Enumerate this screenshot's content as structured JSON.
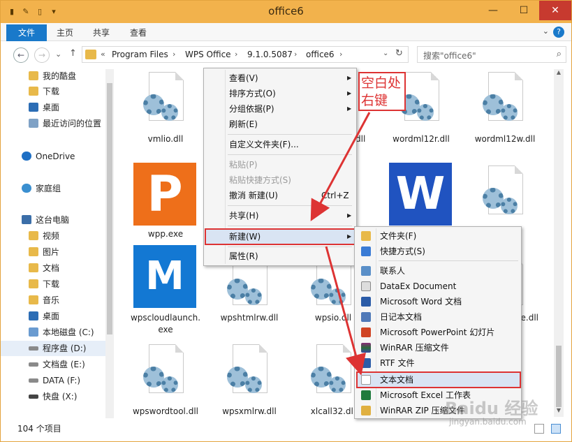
{
  "window": {
    "title": "office6"
  },
  "titlebar_buttons": {
    "minimize": "—",
    "maximize": "☐",
    "close": "✕"
  },
  "ribbon": {
    "tabs": [
      "文件",
      "主页",
      "共享",
      "查看"
    ],
    "help": "?",
    "expand": "⌄"
  },
  "nav": {
    "back": "←",
    "forward": "→",
    "dropdown": "⌄",
    "up": "↑"
  },
  "address": {
    "prefix": "«",
    "segments": [
      "Program Files",
      "WPS Office",
      "9.1.0.5087",
      "office6"
    ],
    "sep": "›",
    "caret": "⌄",
    "refresh": "↻"
  },
  "search": {
    "placeholder": "搜索\"office6\"",
    "icon": "⌕"
  },
  "navpane": {
    "items": [
      {
        "label": "我的酷盘",
        "icon": "folder-icon"
      },
      {
        "label": "下载",
        "icon": "download-folder-icon"
      },
      {
        "label": "桌面",
        "icon": "desktop-icon"
      },
      {
        "label": "最近访问的位置",
        "icon": "recent-icon"
      },
      {
        "label": "OneDrive",
        "icon": "cloud-icon"
      },
      {
        "label": "家庭组",
        "icon": "homegroup-icon"
      },
      {
        "label": "这台电脑",
        "icon": "computer-icon"
      },
      {
        "label": "视频",
        "icon": "video-folder-icon"
      },
      {
        "label": "图片",
        "icon": "pictures-folder-icon"
      },
      {
        "label": "文档",
        "icon": "documents-folder-icon"
      },
      {
        "label": "下载",
        "icon": "download-folder-icon"
      },
      {
        "label": "音乐",
        "icon": "music-folder-icon"
      },
      {
        "label": "桌面",
        "icon": "desktop-folder-icon"
      },
      {
        "label": "本地磁盘 (C:)",
        "icon": "windows-drive-icon"
      },
      {
        "label": "程序盘 (D:)",
        "icon": "drive-icon"
      },
      {
        "label": "文档盘 (E:)",
        "icon": "drive-icon"
      },
      {
        "label": "DATA (F:)",
        "icon": "drive-icon"
      },
      {
        "label": "快盘 (X:)",
        "icon": "drive-icon"
      }
    ]
  },
  "files": [
    {
      "name": "vmlio.dll",
      "icon": "dll-gear-icon"
    },
    {
      "name": "dll",
      "icon": "dll-gear-icon"
    },
    {
      "name": "wordml12r.dll",
      "icon": "dll-gear-icon"
    },
    {
      "name": "wordml12w.dll",
      "icon": "dll-gear-icon"
    },
    {
      "name": "wpp.exe",
      "icon": "wpp-app-icon"
    },
    {
      "name": "",
      "icon": "wps-writer-icon"
    },
    {
      "name": "",
      "icon": "dll-gear-icon"
    },
    {
      "name": "wpscloudlaunch.exe",
      "icon": "wps-cloud-icon"
    },
    {
      "name": "wpshtmlrw.dll",
      "icon": "dll-gear-icon"
    },
    {
      "name": "wpsio.dll",
      "icon": "dll-gear-icon"
    },
    {
      "name": "e.dll",
      "icon": "dll-gear-icon"
    },
    {
      "name": "wpswordtool.dll",
      "icon": "dll-gear-icon"
    },
    {
      "name": "wpsxmlrw.dll",
      "icon": "dll-gear-icon"
    },
    {
      "name": "xlcall32.dll",
      "icon": "dll-gear-icon"
    }
  ],
  "wpp_letter": "P",
  "wps_letter": "W",
  "cloud_letter": "M",
  "status": {
    "count": "104 个项目"
  },
  "context_menu": {
    "items": [
      {
        "label": "查看(V)",
        "submenu": true,
        "disabled": false
      },
      {
        "label": "排序方式(O)",
        "submenu": true,
        "disabled": false
      },
      {
        "label": "分组依据(P)",
        "submenu": true,
        "disabled": false
      },
      {
        "label": "刷新(E)",
        "submenu": false,
        "disabled": false
      },
      {
        "label": "自定义文件夹(F)...",
        "submenu": false,
        "disabled": false
      },
      {
        "label": "粘贴(P)",
        "submenu": false,
        "disabled": true
      },
      {
        "label": "粘贴快捷方式(S)",
        "submenu": false,
        "disabled": true
      },
      {
        "label": "撤消 新建(U)",
        "shortcut": "Ctrl+Z",
        "submenu": false,
        "disabled": false
      },
      {
        "label": "共享(H)",
        "submenu": true,
        "disabled": false
      },
      {
        "label": "新建(W)",
        "submenu": true,
        "disabled": false
      },
      {
        "label": "属性(R)",
        "submenu": false,
        "disabled": false
      }
    ],
    "submenu_arrow": "▶"
  },
  "new_submenu": {
    "items": [
      {
        "label": "文件夹(F)",
        "icon": "folder-icon"
      },
      {
        "label": "快捷方式(S)",
        "icon": "shortcut-icon"
      },
      {
        "label": "联系人",
        "icon": "contact-icon"
      },
      {
        "label": "DataEx Document",
        "icon": "dataex-icon"
      },
      {
        "label": "Microsoft Word 文档",
        "icon": "word-icon"
      },
      {
        "label": "日记本文档",
        "icon": "journal-icon"
      },
      {
        "label": "Microsoft PowerPoint 幻灯片",
        "icon": "powerpoint-icon"
      },
      {
        "label": "WinRAR 压缩文件",
        "icon": "winrar-icon"
      },
      {
        "label": "RTF 文件",
        "icon": "rtf-icon"
      },
      {
        "label": "文本文档",
        "icon": "text-document-icon"
      },
      {
        "label": "Microsoft Excel 工作表",
        "icon": "excel-icon"
      },
      {
        "label": "WinRAR ZIP 压缩文件",
        "icon": "winrar-zip-icon"
      }
    ]
  },
  "annotation": {
    "line1": "空白处",
    "line2": "右键"
  },
  "watermark": {
    "logo": "Baidu 经验",
    "url": "jingyan.baidu.com"
  },
  "colors": {
    "frame": "#f2b24c",
    "accent": "#1979ca",
    "annotation": "#dd3333"
  }
}
